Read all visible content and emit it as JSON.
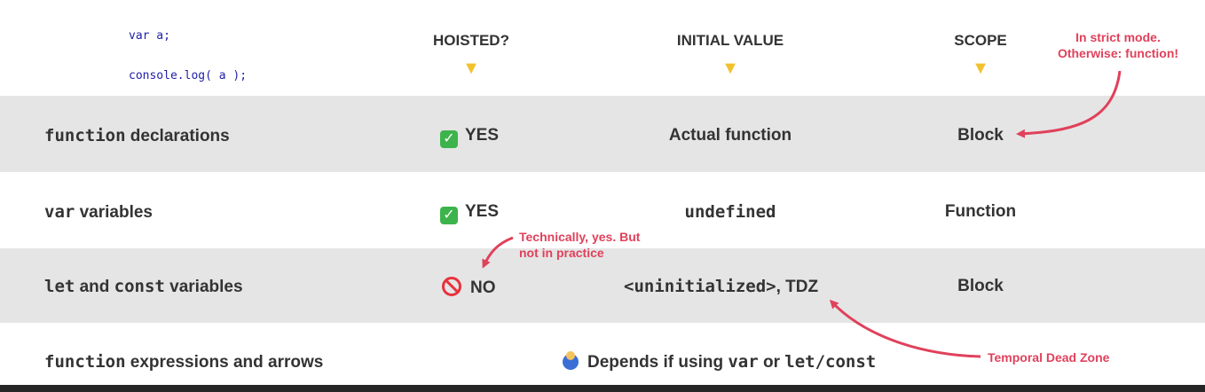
{
  "code": {
    "line1": "var a;",
    "line2": "console.log( a );"
  },
  "headers": {
    "hoisted": "HOISTED?",
    "initial_value": "INITIAL VALUE",
    "scope": "SCOPE",
    "pointer_icon": "pointing-down-emoji"
  },
  "rows": [
    {
      "label_code": "function",
      "label_text": " declarations",
      "hoisted_icon": "check-mark-emoji",
      "hoisted": "YES",
      "initial": "Actual function",
      "scope": "Block"
    },
    {
      "label_code": "var",
      "label_text": " variables",
      "hoisted_icon": "check-mark-emoji",
      "hoisted": "YES",
      "initial": "undefined",
      "scope": "Function"
    },
    {
      "label_code": "let",
      "label_mid": " and ",
      "label_code2": "const",
      "label_text": " variables",
      "hoisted_icon": "no-entry-emoji",
      "hoisted": "NO",
      "initial_code": "<uninitialized>",
      "initial_text": ", TDZ",
      "scope": "Block"
    },
    {
      "label_code": "function",
      "label_text": " expressions and arrows",
      "merged_icon": "shrug-emoji",
      "merged_text": "Depends if using ",
      "merged_code1": "var",
      "merged_mid": " or ",
      "merged_code2": "let/const"
    }
  ],
  "notes": {
    "strict_line1": "In strict mode.",
    "strict_line2": "Otherwise: function!",
    "technically_line1": "Technically, yes. But",
    "technically_line2": "not in practice",
    "tdz": "Temporal Dead Zone"
  },
  "colors": {
    "accent": "#e0415b",
    "band_gray": "#e5e5e5",
    "code_blue": "#1f1fa8",
    "check_green": "#3cb44b"
  }
}
